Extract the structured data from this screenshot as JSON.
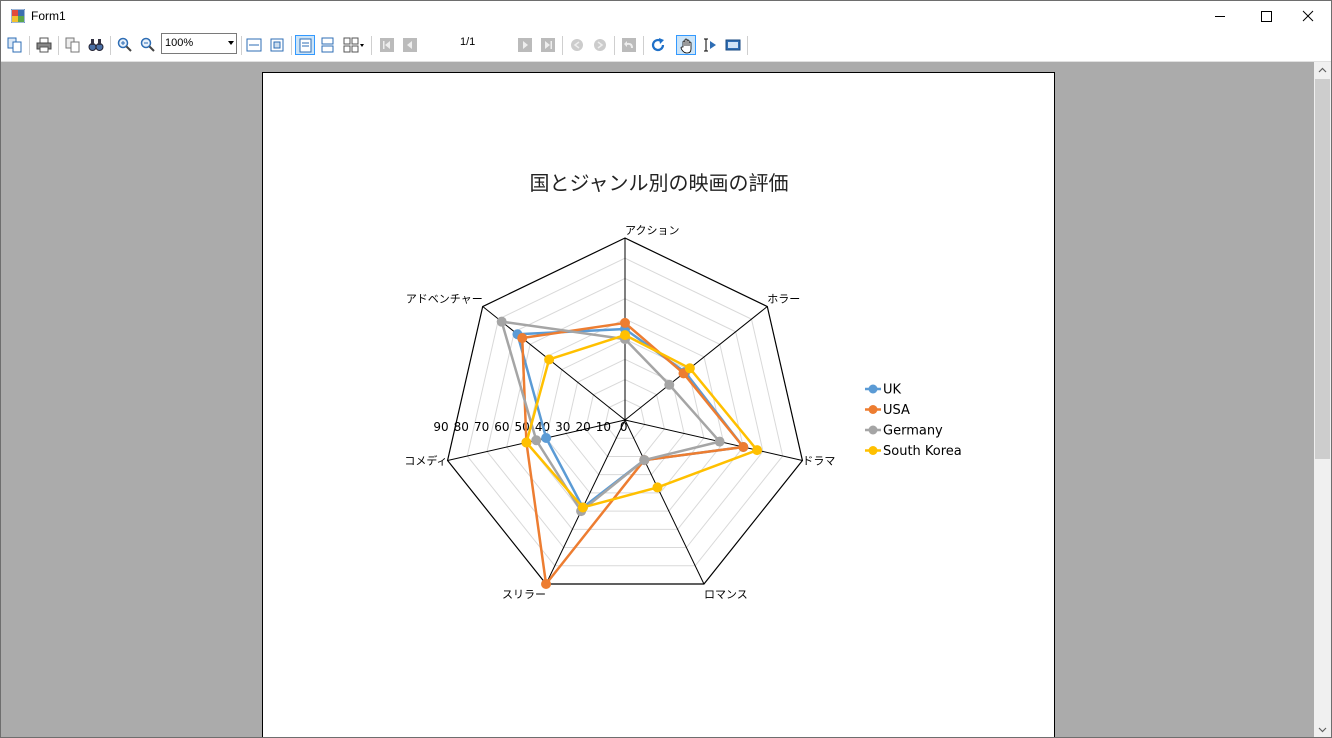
{
  "window": {
    "title": "Form1"
  },
  "toolbar": {
    "zoom_value": "100%",
    "page_indicator": "1/1",
    "buttons": [
      "copy-pages",
      "print",
      "copy",
      "find",
      "zoom-in",
      "zoom-out",
      "page-width",
      "whole-page",
      "single-page",
      "continuous",
      "multi-page",
      "first-page",
      "prev-page",
      "next-page",
      "last-page",
      "back",
      "forward",
      "undo",
      "refresh",
      "pan",
      "select",
      "snapshot"
    ]
  },
  "chart_data": {
    "type": "radar",
    "title": "国とジャンル別の映画の評価",
    "categories": [
      "アクション",
      "ホラー",
      "ドラマ",
      "ロマンス",
      "スリラー",
      "コメディ",
      "アドベンチャー"
    ],
    "axis_ticks": [
      "90",
      "80",
      "70",
      "60",
      "50",
      "40",
      "30",
      "20",
      "10",
      "0"
    ],
    "range": [
      0,
      90
    ],
    "grid": true,
    "legend_position": "right",
    "series": [
      {
        "name": "UK",
        "color": "#5b9bd5",
        "values": [
          45,
          38,
          60,
          22,
          48,
          40,
          68
        ]
      },
      {
        "name": "USA",
        "color": "#ed7d31",
        "values": [
          48,
          37,
          60,
          22,
          90,
          50,
          65
        ]
      },
      {
        "name": "Germany",
        "color": "#a5a5a5",
        "values": [
          40,
          28,
          48,
          22,
          50,
          45,
          78
        ]
      },
      {
        "name": "South Korea",
        "color": "#ffc000",
        "values": [
          42,
          41,
          67,
          37,
          48,
          50,
          48
        ]
      }
    ]
  }
}
